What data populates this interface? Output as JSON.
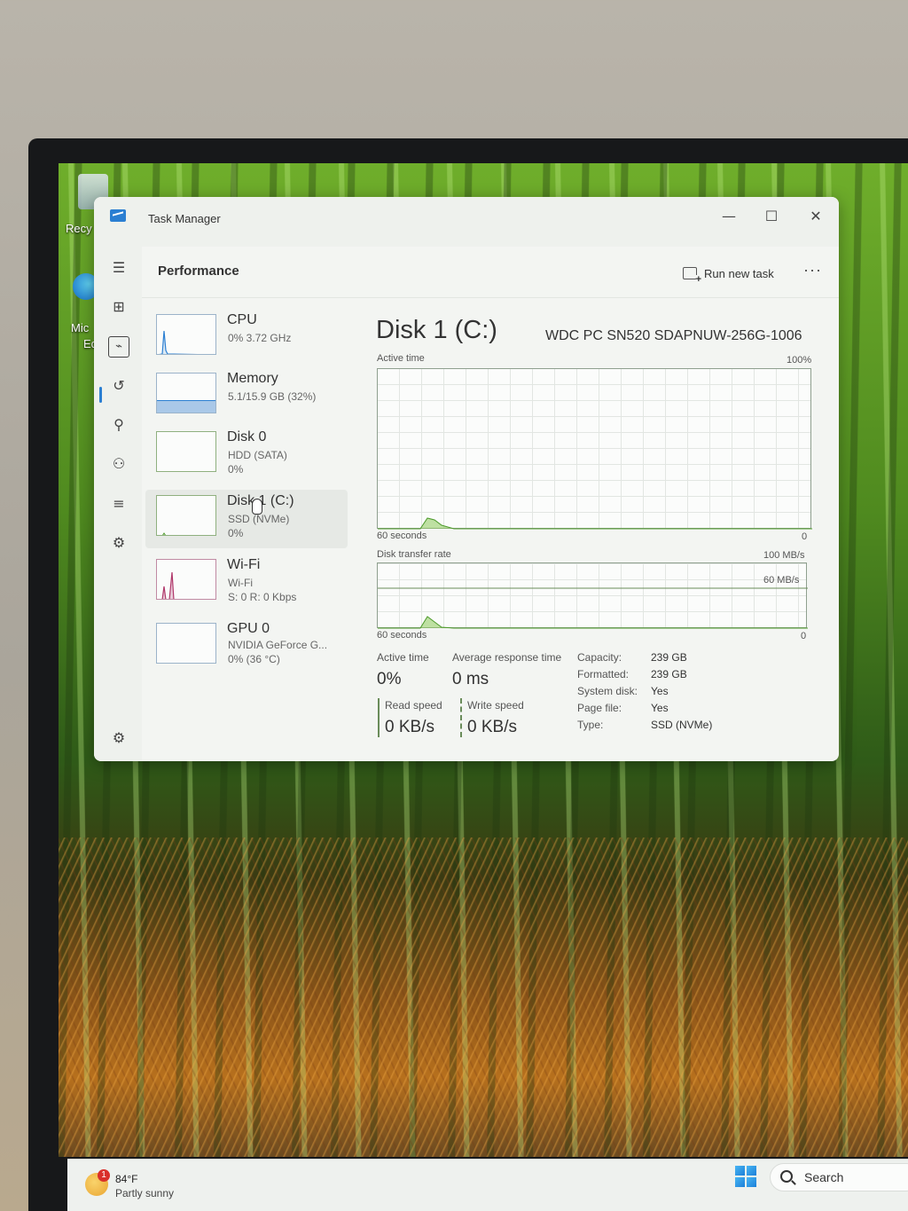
{
  "desktop": {
    "icons": [
      {
        "label": "Recy",
        "name": "recycle-bin-icon"
      },
      {
        "label": "Mic",
        "name": "edge-shortcut-icon"
      },
      {
        "label": "Ed",
        "name": "edge-shortcut-label"
      }
    ]
  },
  "window": {
    "title": "Task Manager",
    "controls": {
      "minimize": "—",
      "maximize": "☐",
      "close": "✕"
    }
  },
  "nav": {
    "items": [
      {
        "name": "hamburger-menu-icon",
        "glyph": "☰"
      },
      {
        "name": "processes-icon",
        "glyph": "⊞"
      },
      {
        "name": "performance-icon",
        "glyph": "⌁"
      },
      {
        "name": "app-history-icon",
        "glyph": "↺"
      },
      {
        "name": "startup-apps-icon",
        "glyph": "⚲"
      },
      {
        "name": "users-icon",
        "glyph": "⚇"
      },
      {
        "name": "details-icon",
        "glyph": "≡"
      },
      {
        "name": "services-icon",
        "glyph": "⚙"
      },
      {
        "name": "settings-icon",
        "glyph": "⚙"
      }
    ]
  },
  "header": {
    "page_title": "Performance",
    "run_new_task": "Run new task",
    "more": "···"
  },
  "resources": [
    {
      "name": "CPU",
      "line1": "0% 3.72 GHz",
      "line2": "",
      "color": "#2b7fd2"
    },
    {
      "name": "Memory",
      "line1": "5.1/15.9 GB (32%)",
      "line2": "",
      "color": "#2b7fd2",
      "fill": 0.32
    },
    {
      "name": "Disk 0",
      "line1": "HDD (SATA)",
      "line2": "0%",
      "color": "#4c9a2a"
    },
    {
      "name": "Disk 1 (C:)",
      "line1": "SSD (NVMe)",
      "line2": "0%",
      "color": "#4c9a2a"
    },
    {
      "name": "Wi-Fi",
      "line1": "Wi-Fi",
      "line2": "S: 0 R: 0 Kbps",
      "color": "#b0376a"
    },
    {
      "name": "GPU 0",
      "line1": "NVIDIA GeForce G...",
      "line2": "0% (36 °C)",
      "color": "#2b7fd2"
    }
  ],
  "detail": {
    "title": "Disk 1 (C:)",
    "model": "WDC PC SN520 SDAPNUW-256G-1006",
    "active_time_graph": {
      "label": "Active time",
      "max": "100%",
      "duration": "60 seconds",
      "min": "0"
    },
    "transfer_graph": {
      "label": "Disk transfer rate",
      "max": "100 MB/s",
      "ref_line": "60 MB/s",
      "duration": "60 seconds",
      "min": "0"
    },
    "stats": {
      "active_time_label": "Active time",
      "active_time_value": "0%",
      "avg_response_label": "Average response time",
      "avg_response_value": "0 ms",
      "read_speed_label": "Read speed",
      "read_speed_value": "0 KB/s",
      "write_speed_label": "Write speed",
      "write_speed_value": "0 KB/s"
    },
    "properties": [
      {
        "label": "Capacity:",
        "value": "239 GB"
      },
      {
        "label": "Formatted:",
        "value": "239 GB"
      },
      {
        "label": "System disk:",
        "value": "Yes"
      },
      {
        "label": "Page file:",
        "value": "Yes"
      },
      {
        "label": "Type:",
        "value": "SSD (NVMe)"
      }
    ]
  },
  "taskbar": {
    "weather_badge": "1",
    "weather_temp": "84°F",
    "weather_condition": "Partly sunny",
    "search_label": "Search"
  }
}
